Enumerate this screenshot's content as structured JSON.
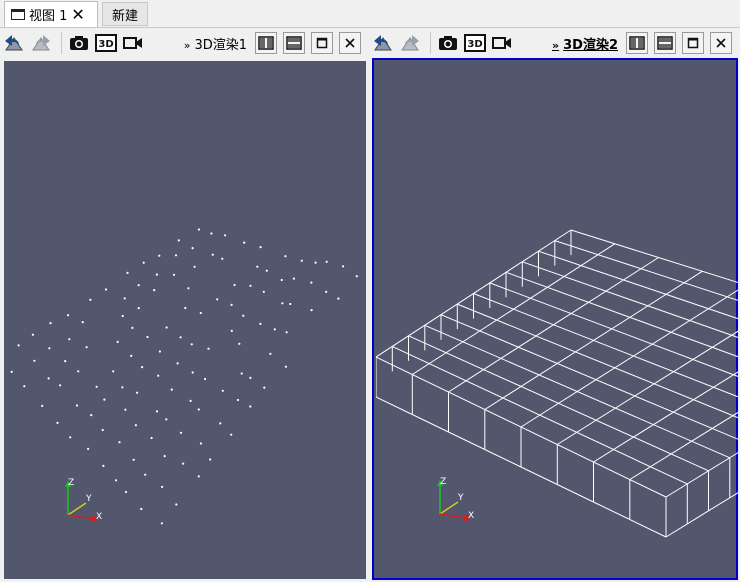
{
  "tabs": [
    {
      "label": "视图 1",
      "active": true,
      "close_glyph": "✕"
    },
    {
      "label": "新建",
      "active": false
    }
  ],
  "views": [
    {
      "title": "3D渲染1",
      "active": false,
      "content": "point-cloud"
    },
    {
      "title": "3D渲染2",
      "active": true,
      "content": "wireframe-grid"
    }
  ],
  "toolbar": {
    "chevron": "»",
    "icons": [
      "reset-camera-icon",
      "redo-camera-icon",
      "screenshot-camera-icon",
      "3d-toggle-icon",
      "record-video-icon"
    ],
    "icon_3d_label": "3D",
    "split_buttons": [
      "split-horizontal-icon",
      "split-vertical-icon",
      "maximize-icon",
      "close-view-icon"
    ]
  },
  "axes": {
    "z": "Z",
    "y": "Y",
    "x": "X"
  },
  "colors": {
    "viewport_bg": "#52576e",
    "active_border": "#0000c8",
    "axis_x": "#d02020",
    "axis_y": "#d8c820",
    "axis_z": "#20c020",
    "wire": "#ffffff"
  }
}
